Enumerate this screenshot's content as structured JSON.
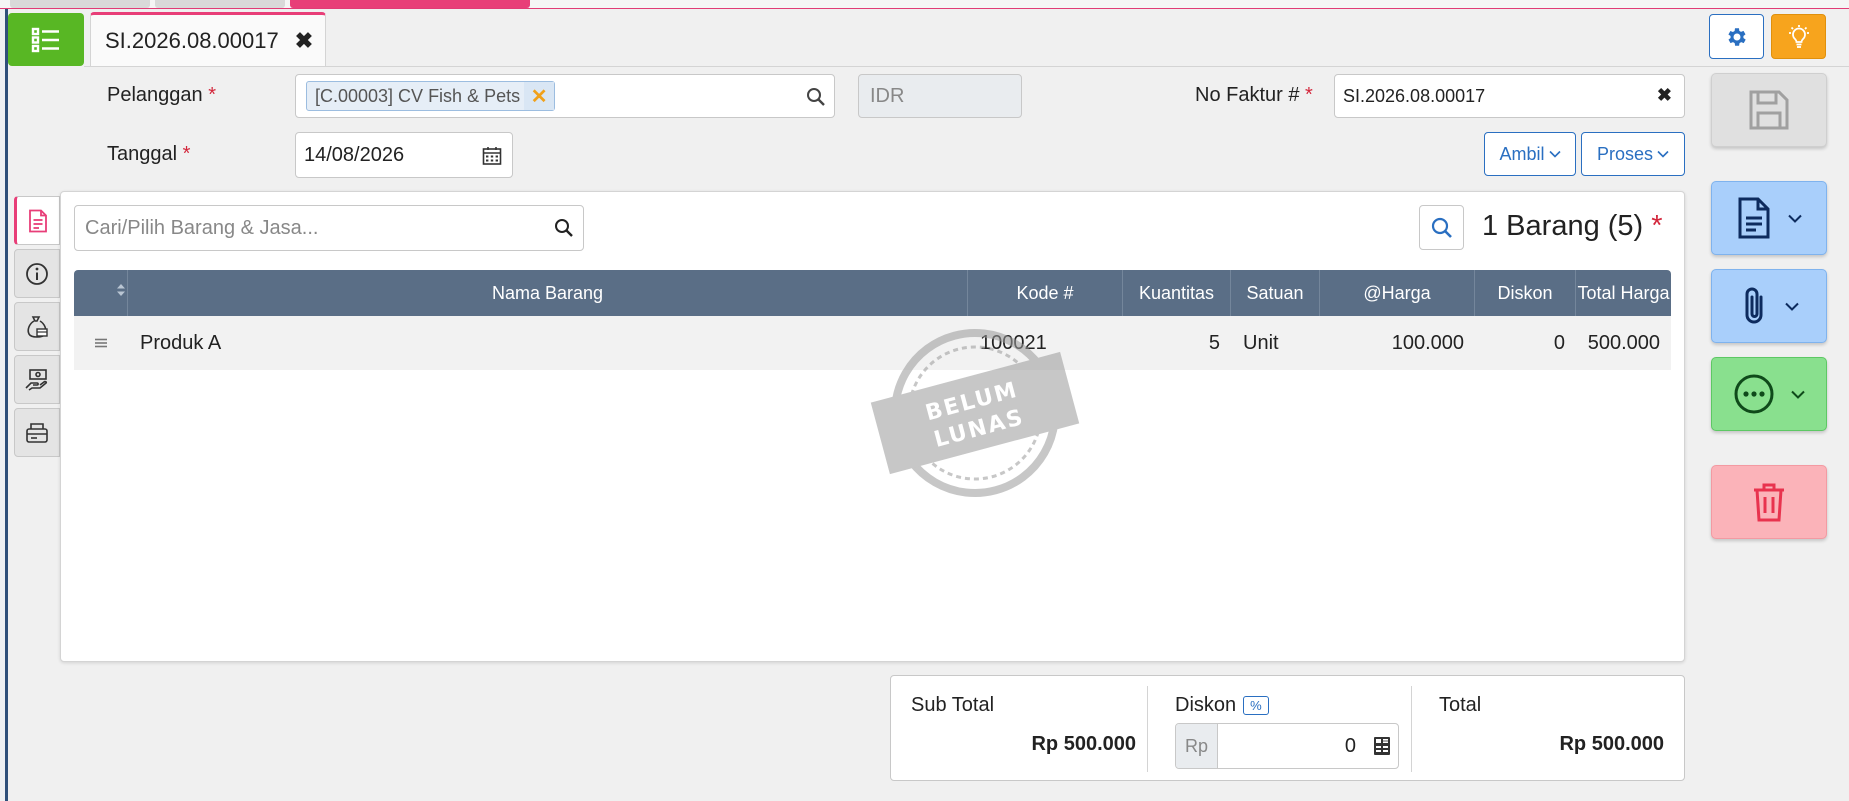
{
  "document_tab": {
    "title": "SI.2026.08.00017"
  },
  "form": {
    "customer": {
      "label": "Pelanggan",
      "required_mark": "*",
      "chip": "[C.00003] CV Fish & Pets"
    },
    "currency": {
      "value": "IDR"
    },
    "invoice_no": {
      "label": "No Faktur #",
      "required_mark": "*",
      "value": "SI.2026.08.00017"
    },
    "date": {
      "label": "Tanggal",
      "required_mark": "*",
      "value": "14/08/2026"
    },
    "ambil_label": "Ambil",
    "proses_label": "Proses"
  },
  "items": {
    "search_placeholder": "Cari/Pilih Barang & Jasa...",
    "count_label": "1 Barang (5)",
    "required_mark": "*",
    "columns": [
      "Nama Barang",
      "Kode #",
      "Kuantitas",
      "Satuan",
      "@Harga",
      "Diskon",
      "Total Harga"
    ],
    "rows": [
      {
        "name": "Produk A",
        "code": "100021",
        "qty": "5",
        "unit": "Unit",
        "price": "100.000",
        "discount": "0",
        "total": "500.000"
      }
    ]
  },
  "stamp": {
    "line1": "BELUM",
    "line2": "LUNAS"
  },
  "footer": {
    "subtotal_label": "Sub Total",
    "subtotal_value": "Rp 500.000",
    "discount_label": "Diskon",
    "discount_badge": "%",
    "discount_prefix": "Rp",
    "discount_value": "0",
    "total_label": "Total",
    "total_value": "Rp 500.000"
  },
  "colors": {
    "accent_pink": "#e83e78",
    "menu_green": "#58b724",
    "primary_blue": "#2a6fc1",
    "table_header": "#5a6e86",
    "bulb_orange": "#f7a41d"
  },
  "icons": [
    "list-menu-icon",
    "close-icon",
    "gear-icon",
    "lightbulb-icon",
    "search-icon",
    "calendar-icon",
    "chevron-down-icon",
    "document-icon",
    "info-icon",
    "money-bag-icon",
    "hand-money-icon",
    "card-machine-icon",
    "sort-icon",
    "drag-handle-icon",
    "calculator-icon",
    "save-icon",
    "paperclip-icon",
    "more-icon",
    "trash-icon"
  ]
}
